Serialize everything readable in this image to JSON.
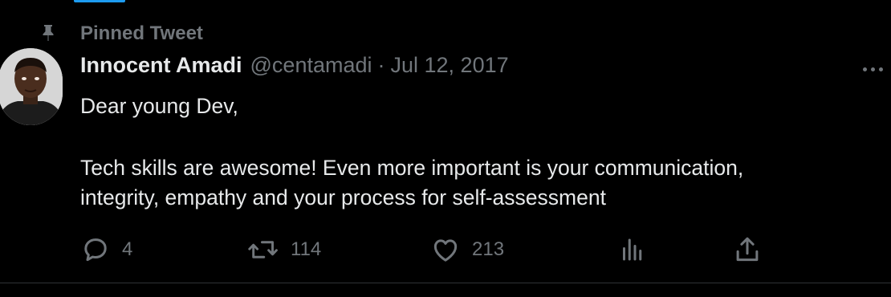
{
  "pinned": {
    "label": "Pinned Tweet",
    "icon": "pin-icon"
  },
  "author": {
    "name": "Innocent Amadi",
    "handle": "@centamadi",
    "separator": "·",
    "date": "Jul 12, 2017"
  },
  "more_icon": "more-icon",
  "tweet_text": {
    "greeting": "Dear young Dev,",
    "line1": "Tech skills are awesome! Even more important is your communication,",
    "line2": "integrity, empathy and your process for self-assessment"
  },
  "actions": {
    "reply": {
      "icon": "reply-icon",
      "count": "4"
    },
    "retweet": {
      "icon": "retweet-icon",
      "count": "114"
    },
    "like": {
      "icon": "heart-icon",
      "count": "213"
    },
    "views": {
      "icon": "analytics-icon"
    },
    "share": {
      "icon": "share-icon"
    }
  },
  "colors": {
    "background": "#000000",
    "text": "#e7e9ea",
    "muted": "#71767b",
    "accent": "#1d9bf0",
    "divider": "#2f3336"
  }
}
